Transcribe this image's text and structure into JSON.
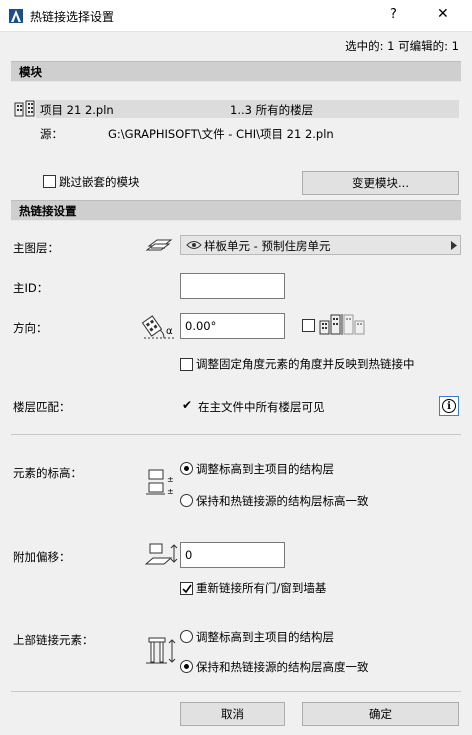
{
  "window": {
    "title": "热链接选择设置",
    "help_label": "?",
    "close_label": "✕"
  },
  "selection_info": "选中的: 1 可编辑的: 1",
  "module_section": {
    "header": "模块",
    "project_name": "项目 21 2.pln",
    "stories_text": "1..3 所有的楼层",
    "source_label": "源：",
    "source_path": "G:\\GRAPHISOFT\\文件 - CHI\\项目 21 2.pln",
    "skip_nested_label": "跳过嵌套的模块",
    "skip_nested_checked": false,
    "change_module_button": "变更模块..."
  },
  "hotlink_settings": {
    "header": "热链接设置",
    "master_layer_label": "主图层：",
    "master_layer_value": "样板单元 - 预制住房单元",
    "master_id_label": "主ID：",
    "master_id_value": "",
    "orientation_label": "方向：",
    "orientation_value": "0.00°",
    "mirror_checked": false,
    "adjust_angle_label": "调整固定角度元素的角度并反映到热链接中",
    "adjust_angle_checked": false,
    "story_match_label": "楼层匹配：",
    "story_match_value": "在主文件中所有楼层可见",
    "story_match_check": "✔",
    "info_label": "i",
    "elevation_label": "元素的标高：",
    "elevation_option1": "调整标高到主项目的结构层",
    "elevation_option2": "保持和热链接源的结构层标高一致",
    "elevation_selected": 1,
    "offset_label": "附加偏移：",
    "offset_value": "0",
    "relink_label": "重新链接所有门/窗到墙基",
    "relink_checked": true,
    "upper_label": "上部链接元素：",
    "upper_option1": "调整标高到主项目的结构层",
    "upper_option2": "保持和热链接源的结构层高度一致",
    "upper_selected": 2
  },
  "footer": {
    "cancel_button": "取消",
    "ok_button": "确定"
  }
}
